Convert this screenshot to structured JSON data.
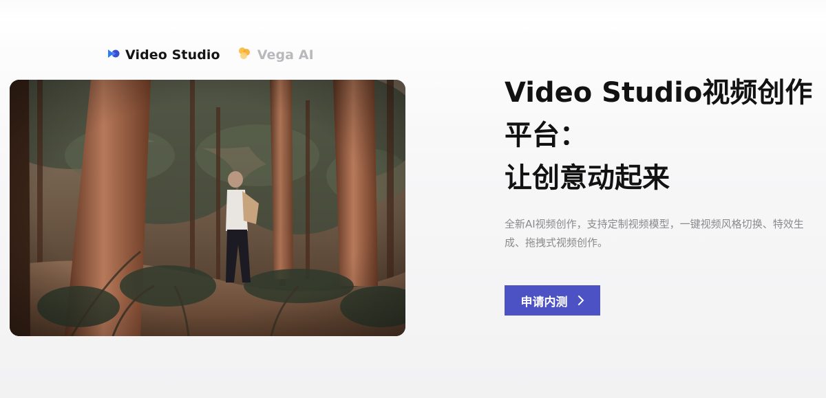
{
  "tabs": [
    {
      "label": "Video Studio",
      "icon": "video-studio-logo-icon",
      "active": true
    },
    {
      "label": "Vega AI",
      "icon": "vega-ai-logo-icon",
      "active": false
    }
  ],
  "hero": {
    "headline_line1": "Video Studio视频创作",
    "headline_line2": "平台：",
    "headline_line3": "让创意动起来",
    "description": "全新AI视频创作，支持定制视频模型，一键视频风格切换、特效生成、拖拽式视频创作。",
    "button_label": "申请内测",
    "button_icon": "chevron-right-icon",
    "image_icon": "forest-hiker-video-still"
  },
  "colors": {
    "accent": "#4c52c4",
    "title": "#121212",
    "muted": "#8a8a8e",
    "inactive_tab": "#b9b9bd",
    "logo_blue": "#3a5bd9",
    "logo_orange": "#f5a623"
  }
}
